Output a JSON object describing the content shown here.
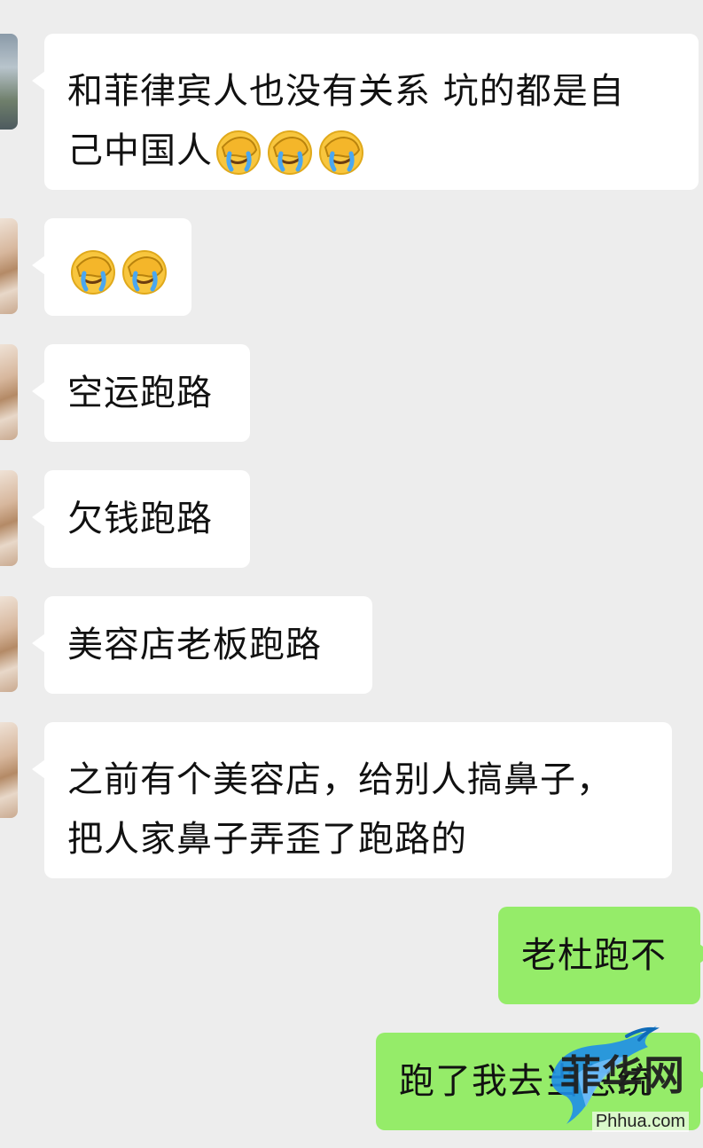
{
  "messages": [
    {
      "side": "left",
      "text_lines": [
        "和菲律宾人也没有关系 坑的都是自",
        "己中国人"
      ],
      "emoji_count": 3,
      "emoji_name": "facepalm-crying"
    },
    {
      "side": "left",
      "text_lines": [
        ""
      ],
      "emoji_count": 2,
      "emoji_name": "facepalm-crying"
    },
    {
      "side": "left",
      "text_lines": [
        "空运跑路"
      ]
    },
    {
      "side": "left",
      "text_lines": [
        "欠钱跑路"
      ]
    },
    {
      "side": "left",
      "text_lines": [
        "美容店老板跑路"
      ]
    },
    {
      "side": "left",
      "text_lines": [
        "之前有个美容店，给别人搞鼻子，",
        "把人家鼻子弄歪了跑路的"
      ]
    },
    {
      "side": "right",
      "text_lines": [
        "老杜跑不"
      ]
    },
    {
      "side": "right",
      "text_lines": [
        "跑了我去当总统"
      ]
    }
  ],
  "colors": {
    "background": "#ededed",
    "incoming_bubble": "#ffffff",
    "outgoing_bubble": "#95ec69",
    "text": "#111111"
  },
  "watermark": {
    "brand": "菲华网",
    "url": "Phhua.com"
  }
}
